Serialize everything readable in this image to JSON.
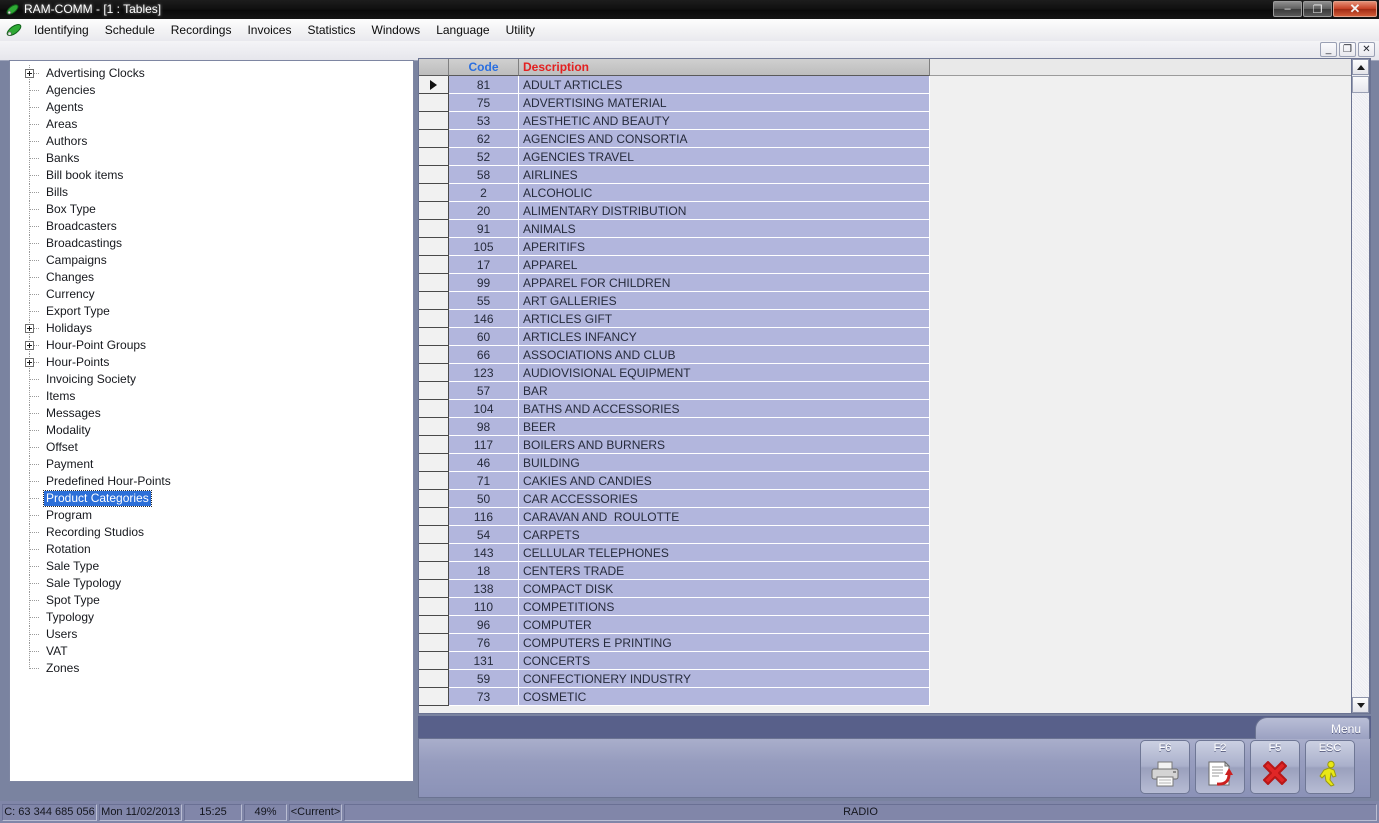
{
  "window": {
    "title": "RAM-COMM - [1 : Tables]",
    "title_icon": "app-leaf-icon",
    "minimize_label": "–",
    "restore_label": "❐",
    "close_label": "✕"
  },
  "mdi": {
    "minimize_label": "_",
    "restore_label": "❐",
    "close_label": "✕"
  },
  "menubar": {
    "items": [
      {
        "label": "Identifying"
      },
      {
        "label": "Schedule"
      },
      {
        "label": "Recordings"
      },
      {
        "label": "Invoices"
      },
      {
        "label": "Statistics"
      },
      {
        "label": "Windows"
      },
      {
        "label": "Language"
      },
      {
        "label": "Utility"
      }
    ]
  },
  "tree": {
    "selected": "Product Categories",
    "items": [
      {
        "label": "Advertising Clocks",
        "expandable": true
      },
      {
        "label": "Agencies",
        "expandable": false
      },
      {
        "label": "Agents",
        "expandable": false
      },
      {
        "label": "Areas",
        "expandable": false
      },
      {
        "label": "Authors",
        "expandable": false
      },
      {
        "label": "Banks",
        "expandable": false
      },
      {
        "label": "Bill book items",
        "expandable": false
      },
      {
        "label": "Bills",
        "expandable": false
      },
      {
        "label": "Box Type",
        "expandable": false
      },
      {
        "label": "Broadcasters",
        "expandable": false
      },
      {
        "label": "Broadcastings",
        "expandable": false
      },
      {
        "label": "Campaigns",
        "expandable": false
      },
      {
        "label": "Changes",
        "expandable": false
      },
      {
        "label": "Currency",
        "expandable": false
      },
      {
        "label": "Export Type",
        "expandable": false
      },
      {
        "label": "Holidays",
        "expandable": true
      },
      {
        "label": "Hour-Point Groups",
        "expandable": true
      },
      {
        "label": "Hour-Points",
        "expandable": true
      },
      {
        "label": "Invoicing Society",
        "expandable": false
      },
      {
        "label": "Items",
        "expandable": false
      },
      {
        "label": "Messages",
        "expandable": false
      },
      {
        "label": "Modality",
        "expandable": false
      },
      {
        "label": "Offset",
        "expandable": false
      },
      {
        "label": "Payment",
        "expandable": false
      },
      {
        "label": "Predefined Hour-Points",
        "expandable": false
      },
      {
        "label": "Product Categories",
        "expandable": false,
        "selected": true
      },
      {
        "label": "Program",
        "expandable": false
      },
      {
        "label": "Recording Studios",
        "expandable": false
      },
      {
        "label": "Rotation",
        "expandable": false
      },
      {
        "label": "Sale Type",
        "expandable": false
      },
      {
        "label": "Sale Typology",
        "expandable": false
      },
      {
        "label": "Spot Type",
        "expandable": false
      },
      {
        "label": "Typology",
        "expandable": false
      },
      {
        "label": "Users",
        "expandable": false
      },
      {
        "label": "VAT",
        "expandable": false
      },
      {
        "label": "Zones",
        "expandable": false
      }
    ]
  },
  "grid": {
    "columns": [
      {
        "key": "code",
        "label": "Code",
        "color": "#2b6fe0"
      },
      {
        "key": "description",
        "label": "Description",
        "color": "#e32020"
      }
    ],
    "current_row_index": 0,
    "rows": [
      {
        "code": "81",
        "description": "ADULT ARTICLES"
      },
      {
        "code": "75",
        "description": "ADVERTISING MATERIAL"
      },
      {
        "code": "53",
        "description": "AESTHETIC AND BEAUTY"
      },
      {
        "code": "62",
        "description": "AGENCIES AND CONSORTIA"
      },
      {
        "code": "52",
        "description": "AGENCIES TRAVEL"
      },
      {
        "code": "58",
        "description": "AIRLINES"
      },
      {
        "code": "2",
        "description": "ALCOHOLIC"
      },
      {
        "code": "20",
        "description": "ALIMENTARY DISTRIBUTION"
      },
      {
        "code": "91",
        "description": "ANIMALS"
      },
      {
        "code": "105",
        "description": "APERITIFS"
      },
      {
        "code": "17",
        "description": "APPAREL"
      },
      {
        "code": "99",
        "description": "APPAREL FOR CHILDREN"
      },
      {
        "code": "55",
        "description": "ART GALLERIES"
      },
      {
        "code": "146",
        "description": "ARTICLES GIFT"
      },
      {
        "code": "60",
        "description": "ARTICLES INFANCY"
      },
      {
        "code": "66",
        "description": "ASSOCIATIONS AND CLUB"
      },
      {
        "code": "123",
        "description": "AUDIOVISIONAL EQUIPMENT"
      },
      {
        "code": "57",
        "description": "BAR"
      },
      {
        "code": "104",
        "description": "BATHS AND ACCESSORIES"
      },
      {
        "code": "98",
        "description": "BEER"
      },
      {
        "code": "117",
        "description": "BOILERS AND BURNERS"
      },
      {
        "code": "46",
        "description": "BUILDING"
      },
      {
        "code": "71",
        "description": "CAKIES AND CANDIES"
      },
      {
        "code": "50",
        "description": "CAR ACCESSORIES"
      },
      {
        "code": "116",
        "description": "CARAVAN AND  ROULOTTE"
      },
      {
        "code": "54",
        "description": "CARPETS"
      },
      {
        "code": "143",
        "description": "CELLULAR TELEPHONES"
      },
      {
        "code": "18",
        "description": "CENTERS TRADE"
      },
      {
        "code": "138",
        "description": "COMPACT DISK"
      },
      {
        "code": "110",
        "description": "COMPETITIONS"
      },
      {
        "code": "96",
        "description": "COMPUTER"
      },
      {
        "code": "76",
        "description": "COMPUTERS E PRINTING"
      },
      {
        "code": "131",
        "description": "CONCERTS"
      },
      {
        "code": "59",
        "description": "CONFECTIONERY INDUSTRY"
      },
      {
        "code": "73",
        "description": "COSMETIC"
      }
    ]
  },
  "actions": {
    "menu_tab_label": "Menu",
    "buttons": [
      {
        "key": "F6",
        "icon": "printer-icon"
      },
      {
        "key": "F2",
        "icon": "document-arrow-icon"
      },
      {
        "key": "F5",
        "icon": "red-cross-icon"
      },
      {
        "key": "ESC",
        "icon": "exit-runner-icon"
      }
    ]
  },
  "statusbar": {
    "disk": "C: 63 344 685 056",
    "date": "Mon 11/02/2013",
    "time": "15:25",
    "zoom": "49%",
    "context": "<Current>",
    "mode": "RADIO"
  }
}
